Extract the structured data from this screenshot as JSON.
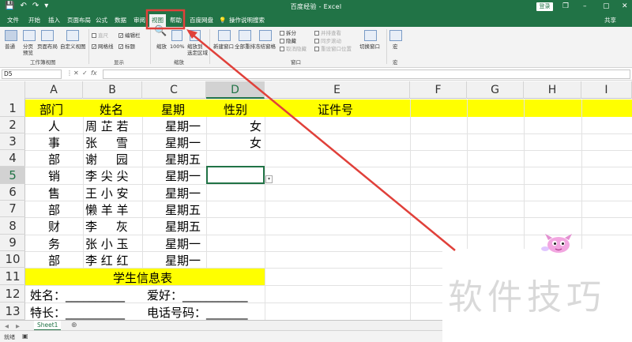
{
  "titlebar": {
    "doc_title": "百度经验 - Excel",
    "login_label": "登录",
    "win_min": "–",
    "win_restore": "❐",
    "win_max": "▢",
    "win_close": "✕",
    "save_glyph": "💾",
    "undo_glyph": "↶",
    "redo_glyph": "↷",
    "customize_glyph": "▾"
  },
  "tabs": [
    {
      "label": "文件"
    },
    {
      "label": "开始"
    },
    {
      "label": "插入"
    },
    {
      "label": "页面布局"
    },
    {
      "label": "公式"
    },
    {
      "label": "数据"
    },
    {
      "label": "审阅"
    },
    {
      "label": "视图"
    },
    {
      "label": "帮助"
    },
    {
      "label": "百度网盘"
    },
    {
      "label": "操作说明搜索"
    }
  ],
  "share_label": "共享",
  "ribbon": {
    "normal": "普通",
    "page_break": "分页\n预览",
    "page_layout": "页面布局",
    "custom_view": "自定义视图",
    "group_workbook_views": "工作簿视图",
    "ruler": "直尺",
    "formula_bar": "编辑栏",
    "gridlines": "网格线",
    "headings": "标题",
    "group_show": "显示",
    "zoom": "缩放",
    "zoom_100": "100%",
    "zoom_selection": "缩放到\n选定区域",
    "group_zoom": "缩放",
    "new_window": "新建窗口",
    "arrange_all": "全部重排",
    "freeze_panes": "冻结窗格",
    "split": "拆分",
    "hide": "隐藏",
    "unhide": "取消隐藏",
    "side_by_side": "并排查看",
    "sync_scroll": "同步滚动",
    "reset_position": "重设窗口位置",
    "switch_windows": "切换窗口",
    "group_window": "窗口",
    "macros": "宏",
    "group_macros": "宏"
  },
  "formula_bar": {
    "name_box": "D5",
    "cancel": "✕",
    "enter": "✓",
    "fx": "fx",
    "value": ""
  },
  "columns": [
    "A",
    "B",
    "C",
    "D",
    "E",
    "F",
    "G",
    "H",
    "I"
  ],
  "rows": [
    "1",
    "2",
    "3",
    "4",
    "5",
    "6",
    "7",
    "8",
    "9",
    "10",
    "11",
    "12",
    "13"
  ],
  "cells": {
    "A1": "部门",
    "B1": "姓名",
    "C1": "星期",
    "D1": "性别",
    "E1": "证件号",
    "A2": "人",
    "B2": "周 芷 若",
    "C2": "星期一",
    "D2": "女",
    "A3": "事",
    "B3": "张     雪",
    "C3": "星期一",
    "D3": "女",
    "A4": "部",
    "B4": "谢     园",
    "C4": "星期五",
    "A5": "销",
    "B5": "李 尖 尖",
    "C5": "星期一",
    "A6": "售",
    "B6": "王 小 安",
    "C6": "星期一",
    "A7": "部",
    "B7": "懒 羊 羊",
    "C7": "星期五",
    "A8": "财",
    "B8": "李     灰",
    "C8": "星期五",
    "A9": "务",
    "B9": "张 小 玉",
    "C9": "星期一",
    "A10": "部",
    "B10": "李 红 红",
    "C10": "星期一",
    "A11": "学生信息表",
    "A12": "姓名：__________",
    "C12": "爱好：___________",
    "A13": "特长：__________",
    "C13": "电话号码：_______"
  },
  "selected_cell": "D5",
  "sheets": [
    {
      "name": "Sheet1"
    }
  ],
  "add_sheet": "⊕",
  "status": {
    "ready": "就绪"
  },
  "watermark": "软件技巧",
  "colors": {
    "excel_green": "#217346",
    "highlight_yellow": "#ffff00",
    "annotation_red": "#e0403a"
  }
}
